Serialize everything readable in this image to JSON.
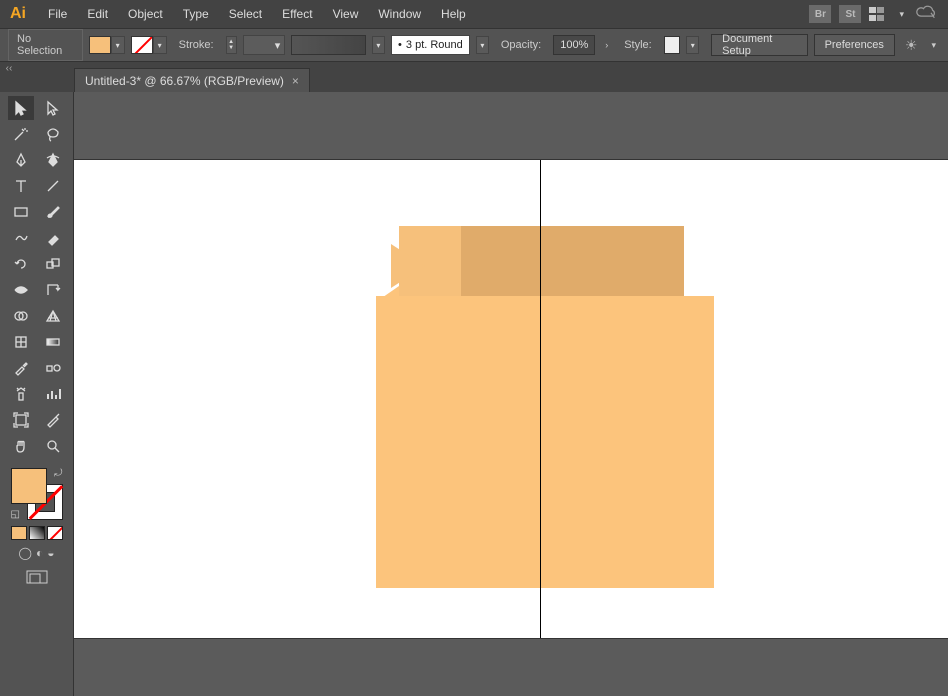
{
  "app": {
    "logo": "Ai"
  },
  "menu": {
    "file": "File",
    "edit": "Edit",
    "object": "Object",
    "type": "Type",
    "select": "Select",
    "effect": "Effect",
    "view": "View",
    "window": "Window",
    "help": "Help",
    "br": "Br",
    "st": "St"
  },
  "controlbar": {
    "selection": "No Selection",
    "stroke_label": "Stroke:",
    "stroke_pt": "3 pt. Round",
    "opacity_label": "Opacity:",
    "opacity_value": "100%",
    "style_label": "Style:",
    "doc_setup": "Document Setup",
    "preferences": "Preferences"
  },
  "tab": {
    "title": "Untitled-3* @ 66.67% (RGB/Preview)",
    "close": "×",
    "collapse": "‹‹"
  },
  "colors": {
    "fill": "#f6c07b",
    "box_light": "#fcc47c",
    "box_dark": "#e0ab6a"
  }
}
